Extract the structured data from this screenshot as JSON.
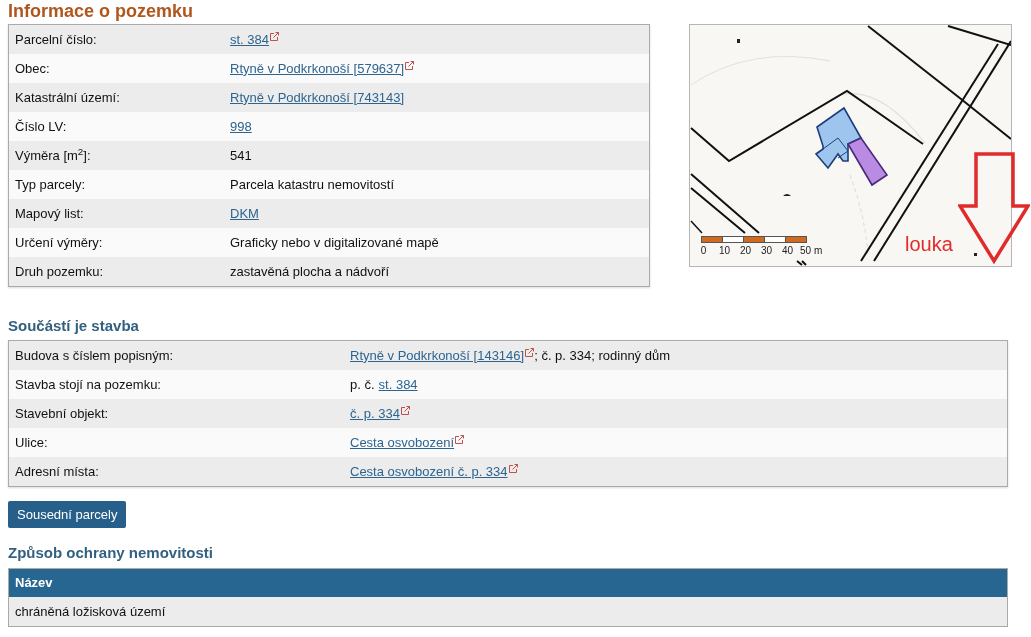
{
  "title": "Informace o pozemku",
  "parcel_table": {
    "rows": [
      {
        "label": "Parcelní číslo:",
        "value": [
          {
            "kind": "link",
            "text": "st. 384",
            "external": true
          }
        ]
      },
      {
        "label": "Obec:",
        "value": [
          {
            "kind": "link",
            "text": "Rtyně v Podkrkonoší [579637]",
            "external": true
          }
        ]
      },
      {
        "label": "Katastrální území:",
        "value": [
          {
            "kind": "link",
            "text": "Rtyně v Podkrkonoší [743143]",
            "external": false
          }
        ]
      },
      {
        "label": "Číslo LV:",
        "value": [
          {
            "kind": "link",
            "text": "998",
            "external": false
          }
        ]
      },
      {
        "label": "Výměra [m$^{2}$]:",
        "value": [
          {
            "kind": "text",
            "text": "541"
          }
        ]
      },
      {
        "label": "Typ parcely:",
        "value": [
          {
            "kind": "text",
            "text": "Parcela katastru nemovitostí"
          }
        ]
      },
      {
        "label": "Mapový list:",
        "value": [
          {
            "kind": "link",
            "text": "DKM",
            "external": false
          }
        ]
      },
      {
        "label": "Určení výměry:",
        "value": [
          {
            "kind": "text",
            "text": "Graficky nebo v digitalizované mapě"
          }
        ]
      },
      {
        "label": "Druh pozemku:",
        "value": [
          {
            "kind": "text",
            "text": "zastavěná plocha a nádvoří"
          }
        ]
      }
    ]
  },
  "map": {
    "scale_labels": [
      "0",
      "10",
      "20",
      "30",
      "40",
      "50 m"
    ],
    "annotation": "louka"
  },
  "building_section": {
    "heading": "Součástí je stavba",
    "rows": [
      {
        "label": "Budova s číslem popisným:",
        "value": [
          {
            "kind": "link",
            "text": "Rtyně v Podkrkonoší [143146]",
            "external": true
          },
          {
            "kind": "text",
            "text": "; č. p. 334; rodinný dům"
          }
        ]
      },
      {
        "label": "Stavba stojí na pozemku:",
        "value": [
          {
            "kind": "text",
            "text": "p. č."
          },
          {
            "kind": "link",
            "text": "st. 384",
            "external": false
          }
        ]
      },
      {
        "label": "Stavební objekt:",
        "value": [
          {
            "kind": "link",
            "text": "č. p. 334",
            "external": true
          }
        ]
      },
      {
        "label": "Ulice:",
        "value": [
          {
            "kind": "link",
            "text": "Cesta osvobození",
            "external": true
          }
        ]
      },
      {
        "label": "Adresní místa:",
        "value": [
          {
            "kind": "link",
            "text": "Cesta osvobození č. p. 334",
            "external": true
          }
        ]
      }
    ]
  },
  "neighbors_button": "Sousední parcely",
  "protection_section": {
    "heading": "Způsob ochrany nemovitosti",
    "columns": [
      "Název"
    ],
    "rows": [
      [
        "chráněná ložisková území"
      ]
    ]
  }
}
